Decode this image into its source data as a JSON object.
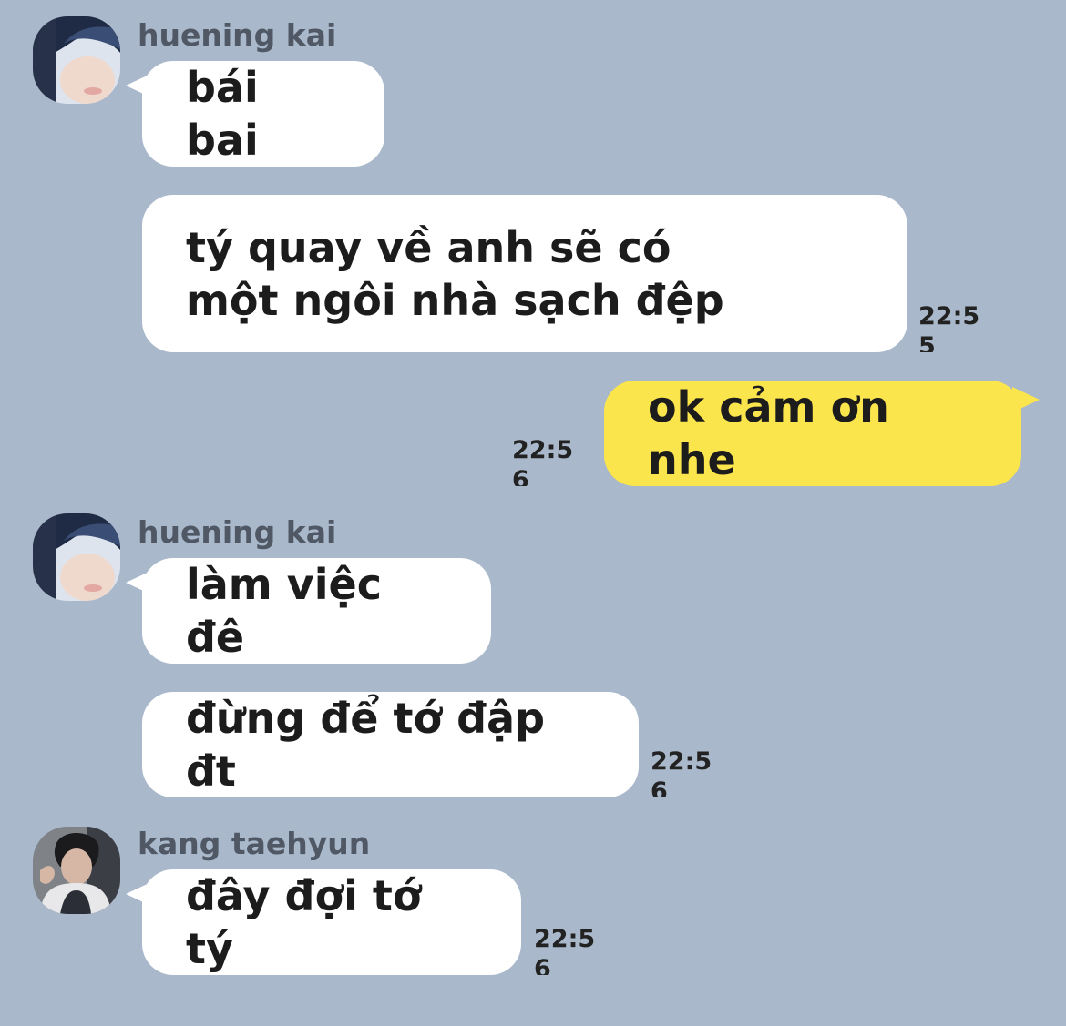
{
  "chat": {
    "incoming_bubble_color": "#ffffff",
    "outgoing_bubble_color": "#fbe54d",
    "background_color": "#a9b8ca",
    "groups": [
      {
        "sender": "huening kai",
        "avatar_icon": "avatar-huening-kai",
        "messages": [
          {
            "text": "bái bai"
          },
          {
            "text": "tý quay về anh sẽ có một ngôi nhà sạch đệp",
            "time": "22:55"
          }
        ]
      },
      {
        "outgoing": true,
        "messages": [
          {
            "text": "ok cảm ơn nhe",
            "time": "22:56"
          }
        ]
      },
      {
        "sender": "huening kai",
        "avatar_icon": "avatar-huening-kai",
        "messages": [
          {
            "text": "làm việc đê"
          },
          {
            "text": "đừng để tớ đập đt",
            "time": "22:56"
          }
        ]
      },
      {
        "sender": "kang taehyun",
        "avatar_icon": "avatar-kang-taehyun",
        "messages": [
          {
            "text": "đây đợi tớ tý",
            "time": "22:56"
          }
        ]
      }
    ]
  }
}
